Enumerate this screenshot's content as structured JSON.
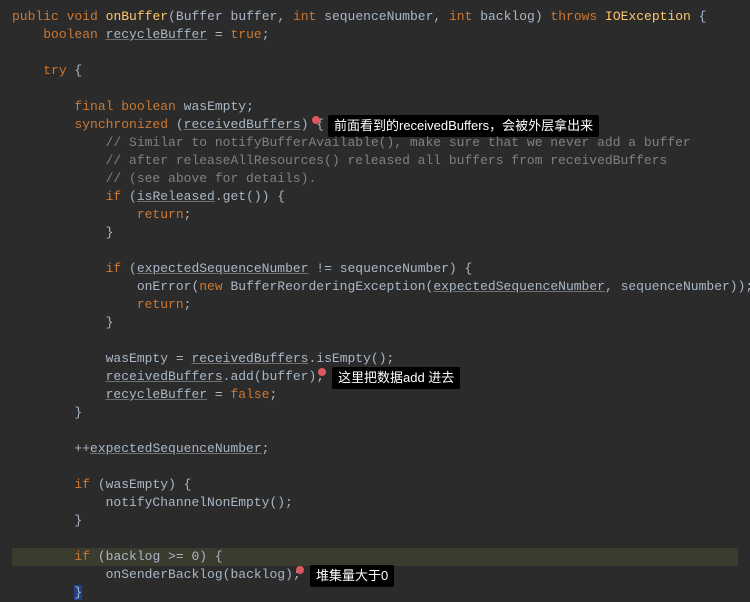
{
  "method_sig": {
    "kw_public": "public",
    "kw_void": "void",
    "name": "onBuffer",
    "p1_t": "Buffer",
    "p1_n": "buffer",
    "p2_t": "int",
    "p2_n": "sequenceNumber",
    "p3_t": "int",
    "p3_n": "backlog",
    "kw_throws": "throws",
    "exc": "IOException"
  },
  "decl_recycle": {
    "kw": "boolean",
    "name": "recycleBuffer",
    "eq": " = ",
    "val": "true"
  },
  "kw_try": "try",
  "decl_wasEmpty": {
    "kw_final": "final",
    "kw_bool": "boolean",
    "name": "wasEmpty"
  },
  "sync": {
    "kw": "synchronized",
    "arg": "receivedBuffers"
  },
  "comments": {
    "c1": "// Similar to notifyBufferAvailable(), make sure that we never add a buffer",
    "c2": "// after releaseAllResources() released all buffers from receivedBuffers",
    "c3": "// (see above for details)."
  },
  "if_released": {
    "kw_if": "if",
    "obj": "isReleased",
    "call": ".get()",
    "kw_return": "return"
  },
  "if_seq": {
    "kw_if": "if",
    "a": "expectedSequenceNumber",
    "op": " != ",
    "b": "sequenceNumber",
    "onError": "onError",
    "kw_new": "new",
    "exc": "BufferReorderingException",
    "arg1": "expectedSequenceNumber",
    "arg2": "sequenceNumber",
    "kw_return": "return"
  },
  "assign_wasEmpty": {
    "lhs": "wasEmpty",
    "op": " = ",
    "obj": "receivedBuffers",
    "call": ".isEmpty()"
  },
  "add": {
    "obj": "receivedBuffers",
    "call": ".add(",
    "arg": "buffer",
    "end": ");"
  },
  "recycle_false": {
    "name": "recycleBuffer",
    "op": " = ",
    "val": "false"
  },
  "inc": {
    "op": "++",
    "name": "expectedSequenceNumber"
  },
  "if_wasEmpty": {
    "kw_if": "if",
    "cond": "wasEmpty",
    "call": "notifyChannelNonEmpty"
  },
  "if_backlog": {
    "kw_if": "if",
    "a": "backlog",
    "op": " >= ",
    "b": "0",
    "call": "onSenderBacklog",
    "arg": "backlog"
  },
  "annotations": {
    "a1": "前面看到的receivedBuffers，会被外层拿出来",
    "a2": "这里把数据add 进去",
    "a3": "堆集量大于0"
  }
}
